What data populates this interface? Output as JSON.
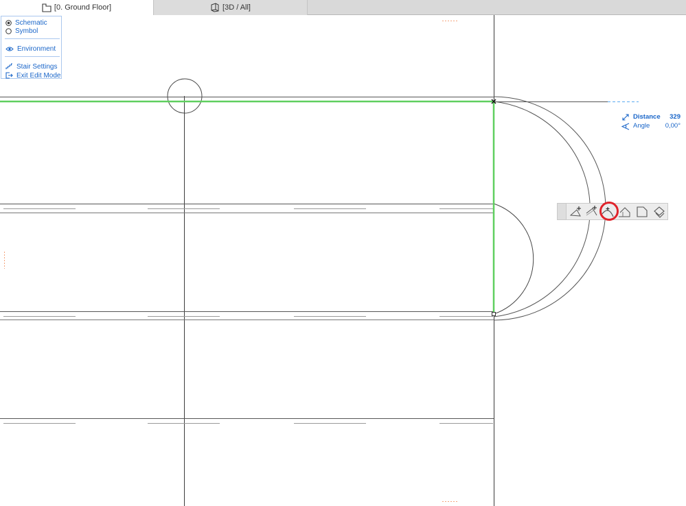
{
  "tabs": [
    {
      "label": "[0. Ground Floor]",
      "icon": "floor-plan-icon",
      "active": true
    },
    {
      "label": "[3D / All]",
      "icon": "3d-view-icon",
      "active": false
    }
  ],
  "edit_palette": {
    "view_options": [
      {
        "label": "Schematic",
        "selected": true
      },
      {
        "label": "Symbol",
        "selected": false
      }
    ],
    "environment_label": "Environment",
    "stair_settings_label": "Stair Settings",
    "exit_edit_label": "Exit Edit Mode"
  },
  "tracker": {
    "distance_label": "Distance",
    "distance_value": "329",
    "angle_label": "Angle",
    "angle_value": "0,00°"
  },
  "pet_palette": {
    "commands": [
      {
        "name": "add-node",
        "icon": "add-node-icon"
      },
      {
        "name": "offset-edge",
        "icon": "offset-edge-icon"
      },
      {
        "name": "curve-edge",
        "icon": "curve-edge-icon",
        "highlighted": true
      },
      {
        "name": "offset-all-edges",
        "icon": "offset-all-icon"
      },
      {
        "name": "fillet-chamfer",
        "icon": "fillet-icon"
      },
      {
        "name": "drag-rotate",
        "icon": "drag-rotate-icon"
      }
    ]
  },
  "colors": {
    "selection_green": "#5fcf5f",
    "accent_blue": "#1a66c9",
    "highlight_red": "#e0232a",
    "line_gray": "#3a3a3a",
    "marker_orange": "#f5a37a"
  }
}
